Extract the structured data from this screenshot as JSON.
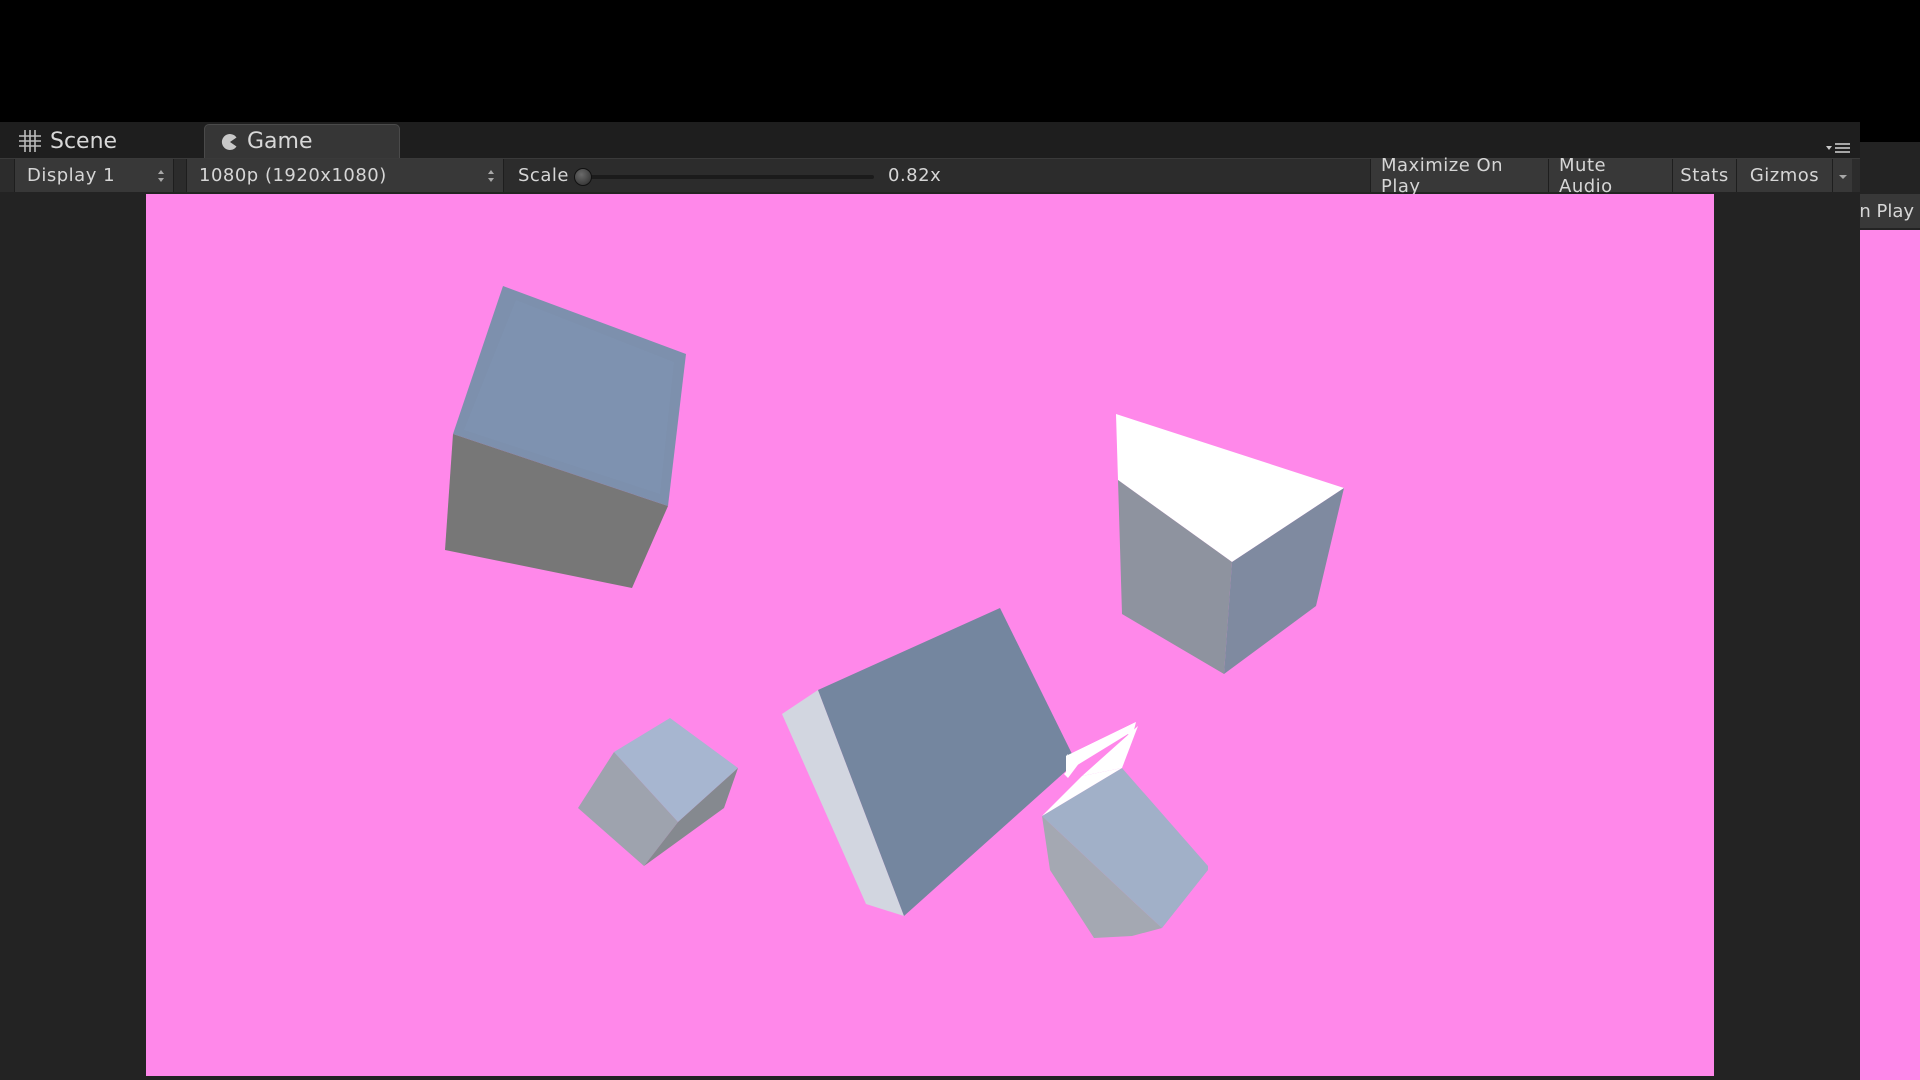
{
  "tabs": {
    "scene_label": "Scene",
    "game_label": "Game"
  },
  "toolbar": {
    "display_label": "Display 1",
    "resolution_label": "1080p (1920x1080)",
    "scale_label": "Scale",
    "scale_value": "0.82x",
    "scale_fraction": 0.0,
    "maximize_label": "Maximize On Play",
    "mute_label": "Mute Audio",
    "stats_label": "Stats",
    "gizmos_label": "Gizmos"
  },
  "side_window": {
    "toolbar_label": "n Play"
  },
  "icons": {
    "scene": "grid-icon",
    "game": "pacman-icon",
    "menu": "tab-menu-icon",
    "dropdown": "up-down-arrows-icon",
    "gizmos_dropdown": "chevron-down-icon"
  },
  "colors": {
    "viewport_background": "#ff88ea",
    "editor_background": "#232323",
    "toolbar_background": "#2c2c2c"
  }
}
